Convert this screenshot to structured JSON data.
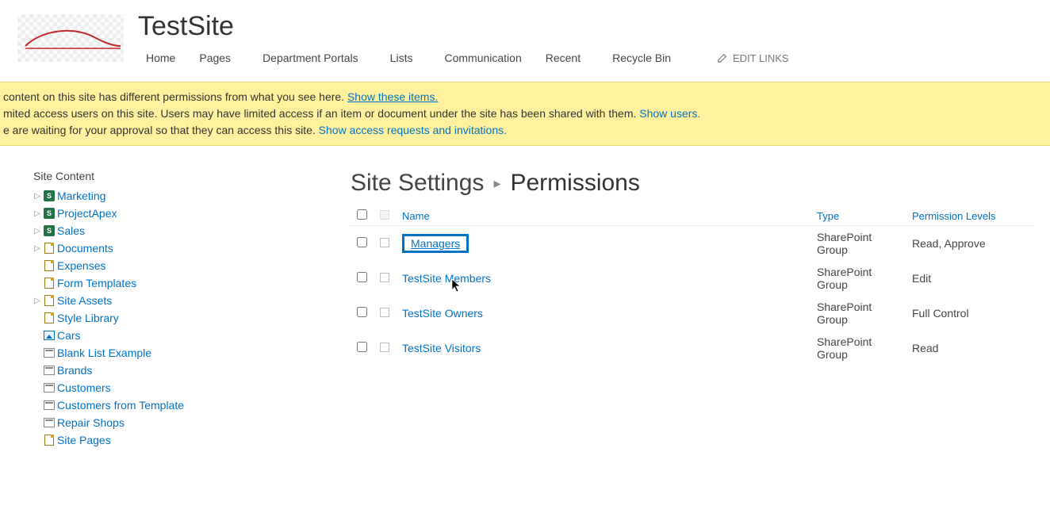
{
  "site": {
    "title": "TestSite"
  },
  "topnav": {
    "items": [
      {
        "label": "Home",
        "hasMenu": false
      },
      {
        "label": "Pages",
        "hasMenu": true
      },
      {
        "label": "Department Portals",
        "hasMenu": true
      },
      {
        "label": "Lists",
        "hasMenu": true
      },
      {
        "label": "Communication",
        "hasMenu": false
      },
      {
        "label": "Recent",
        "hasMenu": true
      },
      {
        "label": "Recycle Bin",
        "hasMenu": false
      }
    ],
    "editLinksLabel": "EDIT LINKS"
  },
  "notifications": {
    "line1_prefix": " content on this site has different permissions from what you see here.  ",
    "line1_link": "Show these items.",
    "line2_prefix": "mited access users on this site. Users may have limited access if an item or document under the site has been shared with them. ",
    "line2_link": "Show users.",
    "line3_prefix": "e are waiting for your approval so that they can access this site. ",
    "line3_link": "Show access requests and invitations."
  },
  "sidebar": {
    "title": "Site Content",
    "items": [
      {
        "label": "Marketing",
        "icon": "sp",
        "expandable": true
      },
      {
        "label": "ProjectApex",
        "icon": "sp",
        "expandable": true
      },
      {
        "label": "Sales",
        "icon": "sp",
        "expandable": true
      },
      {
        "label": "Documents",
        "icon": "doc",
        "expandable": true
      },
      {
        "label": "Expenses",
        "icon": "doc",
        "expandable": false
      },
      {
        "label": "Form Templates",
        "icon": "doc",
        "expandable": false
      },
      {
        "label": "Site Assets",
        "icon": "doc",
        "expandable": true
      },
      {
        "label": "Style Library",
        "icon": "doc",
        "expandable": false
      },
      {
        "label": "Cars",
        "icon": "pic",
        "expandable": false
      },
      {
        "label": "Blank List Example",
        "icon": "list",
        "expandable": false
      },
      {
        "label": "Brands",
        "icon": "list",
        "expandable": false
      },
      {
        "label": "Customers",
        "icon": "list",
        "expandable": false
      },
      {
        "label": "Customers from Template",
        "icon": "list",
        "expandable": false
      },
      {
        "label": "Repair Shops",
        "icon": "list",
        "expandable": false
      },
      {
        "label": "Site Pages",
        "icon": "doc",
        "expandable": false
      }
    ]
  },
  "breadcrumb": {
    "parent": "Site Settings",
    "current": "Permissions"
  },
  "permTable": {
    "headers": {
      "name": "Name",
      "type": "Type",
      "levels": "Permission Levels"
    },
    "rows": [
      {
        "name": "Managers",
        "type": "SharePoint Group",
        "levels": "Read, Approve",
        "highlighted": true
      },
      {
        "name": "TestSite Members",
        "type": "SharePoint Group",
        "levels": "Edit"
      },
      {
        "name": "TestSite Owners",
        "type": "SharePoint Group",
        "levels": "Full Control"
      },
      {
        "name": "TestSite Visitors",
        "type": "SharePoint Group",
        "levels": "Read"
      }
    ]
  }
}
